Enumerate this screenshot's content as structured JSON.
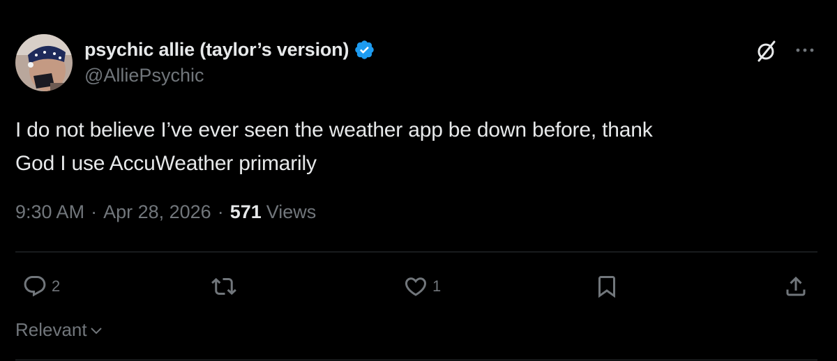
{
  "post": {
    "author": {
      "display_name": "psychic allie (taylor’s version)",
      "handle": "@AlliePsychic",
      "verified": true,
      "avatar_icon": "user-avatar"
    },
    "header_icons": [
      "grok-icon",
      "more-icon"
    ],
    "text_lines": [
      "I do not believe I’ve ever seen the weather app be down before, thank",
      "God I use AccuWeather primarily"
    ],
    "time": "9:30 AM",
    "separator": "·",
    "date": "Apr 28, 2026",
    "views_count": "571",
    "views_label": "Views"
  },
  "actions": {
    "reply_count": "2",
    "retweet_count": "",
    "like_count": "1"
  },
  "replies_sort": {
    "label": "Relevant"
  },
  "colors": {
    "background": "#000000",
    "text_primary": "#e7e9ea",
    "text_secondary": "#71767b",
    "divider": "#2f3336",
    "verified_badge": "#1d9bf0"
  }
}
